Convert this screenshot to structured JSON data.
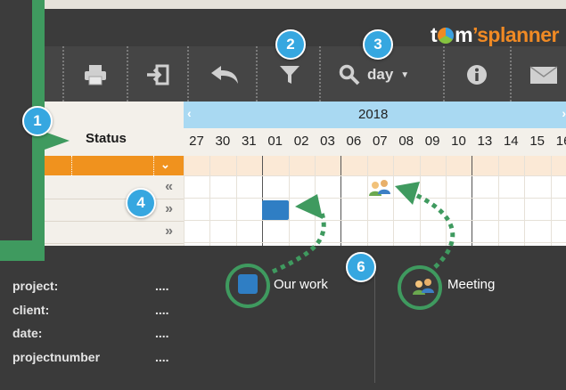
{
  "logo": {
    "part1": "t",
    "part2": "m",
    "part3": "’s",
    "part4": "planner"
  },
  "toolbar": {
    "view_label": "day",
    "icons": [
      "printer-icon",
      "import-icon",
      "undo-icon",
      "filter-icon",
      "search-icon",
      "info-icon",
      "mail-icon"
    ]
  },
  "grid": {
    "status_label": "Status",
    "year": "2018",
    "days": [
      "27",
      "30",
      "31",
      "01",
      "02",
      "03",
      "06",
      "07",
      "08",
      "09",
      "10",
      "13",
      "14",
      "15",
      "16"
    ],
    "rows": [
      {
        "arrow": "«"
      },
      {
        "arrow": "»"
      },
      {
        "arrow": "»"
      }
    ]
  },
  "info": {
    "fields": [
      {
        "label": "project:",
        "value": "...."
      },
      {
        "label": "client:",
        "value": "...."
      },
      {
        "label": "date:",
        "value": "...."
      },
      {
        "label": "projectnumber",
        "value": "...."
      }
    ]
  },
  "legend": {
    "our_work": "Our work",
    "meeting": "Meeting"
  },
  "callouts": [
    "1",
    "2",
    "3",
    "4",
    "6"
  ],
  "colors": {
    "accent_green": "#3f9a5f",
    "callout_blue": "#36a7e0",
    "task_blue": "#2f7ec4",
    "row_orange": "#f0921e",
    "year_bar": "#a9d9f2"
  }
}
